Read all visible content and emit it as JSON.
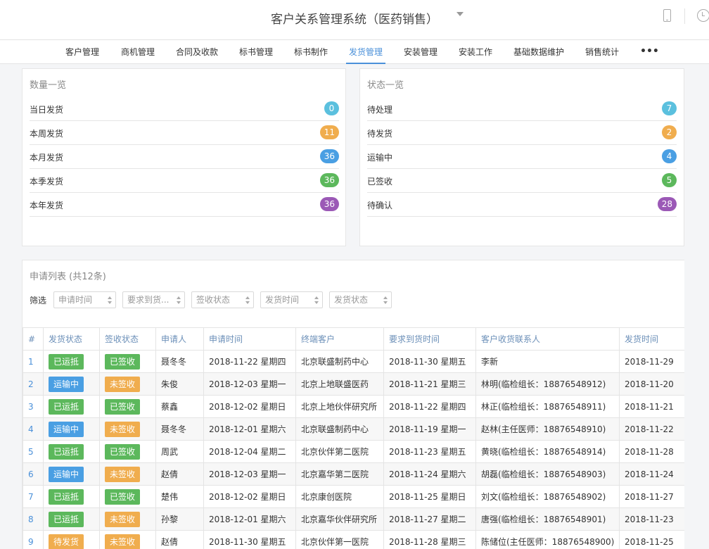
{
  "app": {
    "title": "客户关系管理系统（医药销售）"
  },
  "icons": {
    "dropdown": "caret-down-icon",
    "phone": "mobile-phone-icon",
    "clock": "clock-icon",
    "more": "more-dots-icon"
  },
  "nav": {
    "items": [
      {
        "label": "客户管理"
      },
      {
        "label": "商机管理"
      },
      {
        "label": "合同及收款"
      },
      {
        "label": "标书管理"
      },
      {
        "label": "标书制作"
      },
      {
        "label": "发货管理",
        "active": true
      },
      {
        "label": "安装管理"
      },
      {
        "label": "安装工作"
      },
      {
        "label": "基础数据维护"
      },
      {
        "label": "销售统计"
      }
    ],
    "more": "•••"
  },
  "quantity_panel": {
    "title": "数量一览",
    "rows": [
      {
        "label": "当日发货",
        "count": "0",
        "color": "#5bc0de"
      },
      {
        "label": "本周发货",
        "count": "11",
        "color": "#f0ad4e"
      },
      {
        "label": "本月发货",
        "count": "36",
        "color": "#4a9fe3"
      },
      {
        "label": "本季发货",
        "count": "36",
        "color": "#5cb85c"
      },
      {
        "label": "本年发货",
        "count": "36",
        "color": "#9b59b6"
      }
    ]
  },
  "status_panel": {
    "title": "状态一览",
    "rows": [
      {
        "label": "待处理",
        "count": "7",
        "color": "#5bc0de"
      },
      {
        "label": "待发货",
        "count": "2",
        "color": "#f0ad4e"
      },
      {
        "label": "运输中",
        "count": "4",
        "color": "#4a9fe3"
      },
      {
        "label": "已签收",
        "count": "5",
        "color": "#5cb85c"
      },
      {
        "label": "待确认",
        "count": "28",
        "color": "#9b59b6"
      }
    ]
  },
  "list": {
    "title": "申请列表 (共12条)",
    "filter_label": "筛选",
    "filters": [
      {
        "placeholder": "申请时间"
      },
      {
        "placeholder": "要求到货..."
      },
      {
        "placeholder": "签收状态"
      },
      {
        "placeholder": "发货时间"
      },
      {
        "placeholder": "发货状态"
      }
    ],
    "columns": [
      "#",
      "发货状态",
      "签收状态",
      "申请人",
      "申请时间",
      "终端客户",
      "要求到货时间",
      "客户收货联系人",
      "发货时间"
    ],
    "rows": [
      {
        "no": "1",
        "ship": "已运抵",
        "ship_color": "green",
        "sign": "已签收",
        "sign_color": "green",
        "applicant": "聂冬冬",
        "apply_time": "2018-11-22 星期四",
        "customer": "北京联盛制药中心",
        "due": "2018-11-30 星期五",
        "contact": "李新",
        "ship_time": "2018-11-29"
      },
      {
        "no": "2",
        "ship": "运输中",
        "ship_color": "blue",
        "sign": "未签收",
        "sign_color": "orange",
        "applicant": "朱俊",
        "apply_time": "2018-12-03 星期一",
        "customer": "北京上地联盛医药",
        "due": "2018-11-21 星期三",
        "contact": "林明(临检组长：18876548912)",
        "ship_time": "2018-11-20"
      },
      {
        "no": "3",
        "ship": "已运抵",
        "ship_color": "green",
        "sign": "已签收",
        "sign_color": "green",
        "applicant": "蔡鑫",
        "apply_time": "2018-12-02 星期日",
        "customer": "北京上地伙伴研究所",
        "due": "2018-11-22 星期四",
        "contact": "林正(临检组长：18876548911)",
        "ship_time": "2018-11-21"
      },
      {
        "no": "4",
        "ship": "运输中",
        "ship_color": "blue",
        "sign": "未签收",
        "sign_color": "orange",
        "applicant": "聂冬冬",
        "apply_time": "2018-12-01 星期六",
        "customer": "北京联盛制药中心",
        "due": "2018-11-19 星期一",
        "contact": "赵林(主任医师：18876548910)",
        "ship_time": "2018-11-22"
      },
      {
        "no": "5",
        "ship": "已运抵",
        "ship_color": "green",
        "sign": "已签收",
        "sign_color": "green",
        "applicant": "周武",
        "apply_time": "2018-12-04 星期二",
        "customer": "北京伙伴第二医院",
        "due": "2018-11-23 星期五",
        "contact": "黄晓(临检组长：18876548914)",
        "ship_time": "2018-11-28"
      },
      {
        "no": "6",
        "ship": "运输中",
        "ship_color": "blue",
        "sign": "未签收",
        "sign_color": "orange",
        "applicant": "赵倩",
        "apply_time": "2018-12-03 星期一",
        "customer": "北京嘉华第二医院",
        "due": "2018-11-24 星期六",
        "contact": "胡磊(临检组长：18876548903)",
        "ship_time": "2018-11-24"
      },
      {
        "no": "7",
        "ship": "已运抵",
        "ship_color": "green",
        "sign": "已签收",
        "sign_color": "green",
        "applicant": "楚伟",
        "apply_time": "2018-12-02 星期日",
        "customer": "北京康创医院",
        "due": "2018-11-25 星期日",
        "contact": "刘文(临检组长：18876548902)",
        "ship_time": "2018-11-27"
      },
      {
        "no": "8",
        "ship": "已运抵",
        "ship_color": "green",
        "sign": "未签收",
        "sign_color": "orange",
        "applicant": "孙黎",
        "apply_time": "2018-12-01 星期六",
        "customer": "北京嘉华伙伴研究所",
        "due": "2018-11-27 星期二",
        "contact": "唐强(临检组长：18876548901)",
        "ship_time": "2018-11-23"
      },
      {
        "no": "9",
        "ship": "待发货",
        "ship_color": "orange",
        "sign": "未签收",
        "sign_color": "orange",
        "applicant": "赵倩",
        "apply_time": "2018-11-30 星期五",
        "customer": "北京伙伴第一医院",
        "due": "2018-11-28 星期三",
        "contact": "陈储位(主任医师：18876548900)",
        "ship_time": "2018-11-25"
      }
    ]
  }
}
